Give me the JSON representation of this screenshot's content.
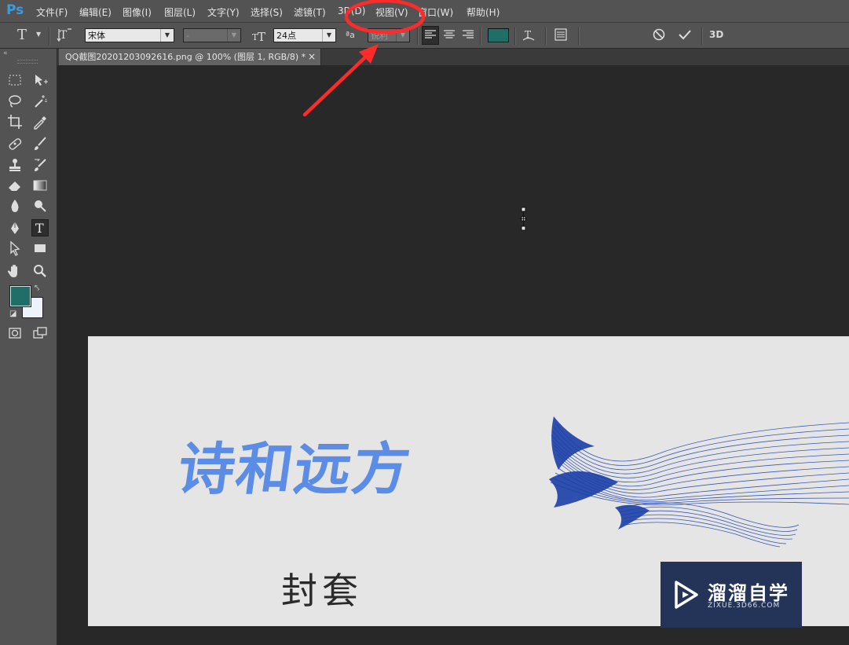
{
  "app": {
    "logo": "Ps"
  },
  "menu": [
    "文件(F)",
    "编辑(E)",
    "图像(I)",
    "图层(L)",
    "文字(Y)",
    "选择(S)",
    "滤镜(T)",
    "3D(D)",
    "视图(V)",
    "窗口(W)",
    "帮助(H)"
  ],
  "options": {
    "tool_glyph": "T",
    "font_family": "宋体",
    "font_style": "-",
    "font_size": "24点",
    "aa_label": "ªa",
    "antialias": "锐利",
    "color": "#1f6e68",
    "threed_label": "3D"
  },
  "document": {
    "tab_title": "QQ截图20201203092616.png @ 100% (图层 1, RGB/8) *",
    "close_glyph": "×"
  },
  "canvas": {
    "poem": "诗和远方",
    "cover": "封套"
  },
  "watermark": {
    "title": "溜溜自学",
    "subtitle": "ZIXUE.3D66.COM"
  },
  "colors": {
    "foreground": "#1f6e68",
    "background": "#eef2fb",
    "annotation": "#ff2a2a"
  }
}
